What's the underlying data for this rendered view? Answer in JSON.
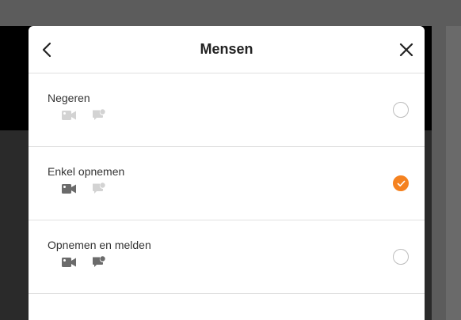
{
  "modal": {
    "title": "Mensen",
    "back_icon": "chevron-left-icon",
    "close_icon": "close-icon"
  },
  "options": [
    {
      "label": "Negeren",
      "video_active": false,
      "notify_active": false,
      "selected": false
    },
    {
      "label": "Enkel opnemen",
      "video_active": true,
      "notify_active": false,
      "selected": true
    },
    {
      "label": "Opnemen en melden",
      "video_active": true,
      "notify_active": true,
      "selected": false
    }
  ],
  "colors": {
    "accent": "#f58220",
    "icon_active": "#6b6b6b",
    "icon_inactive": "#d3d3d3"
  }
}
